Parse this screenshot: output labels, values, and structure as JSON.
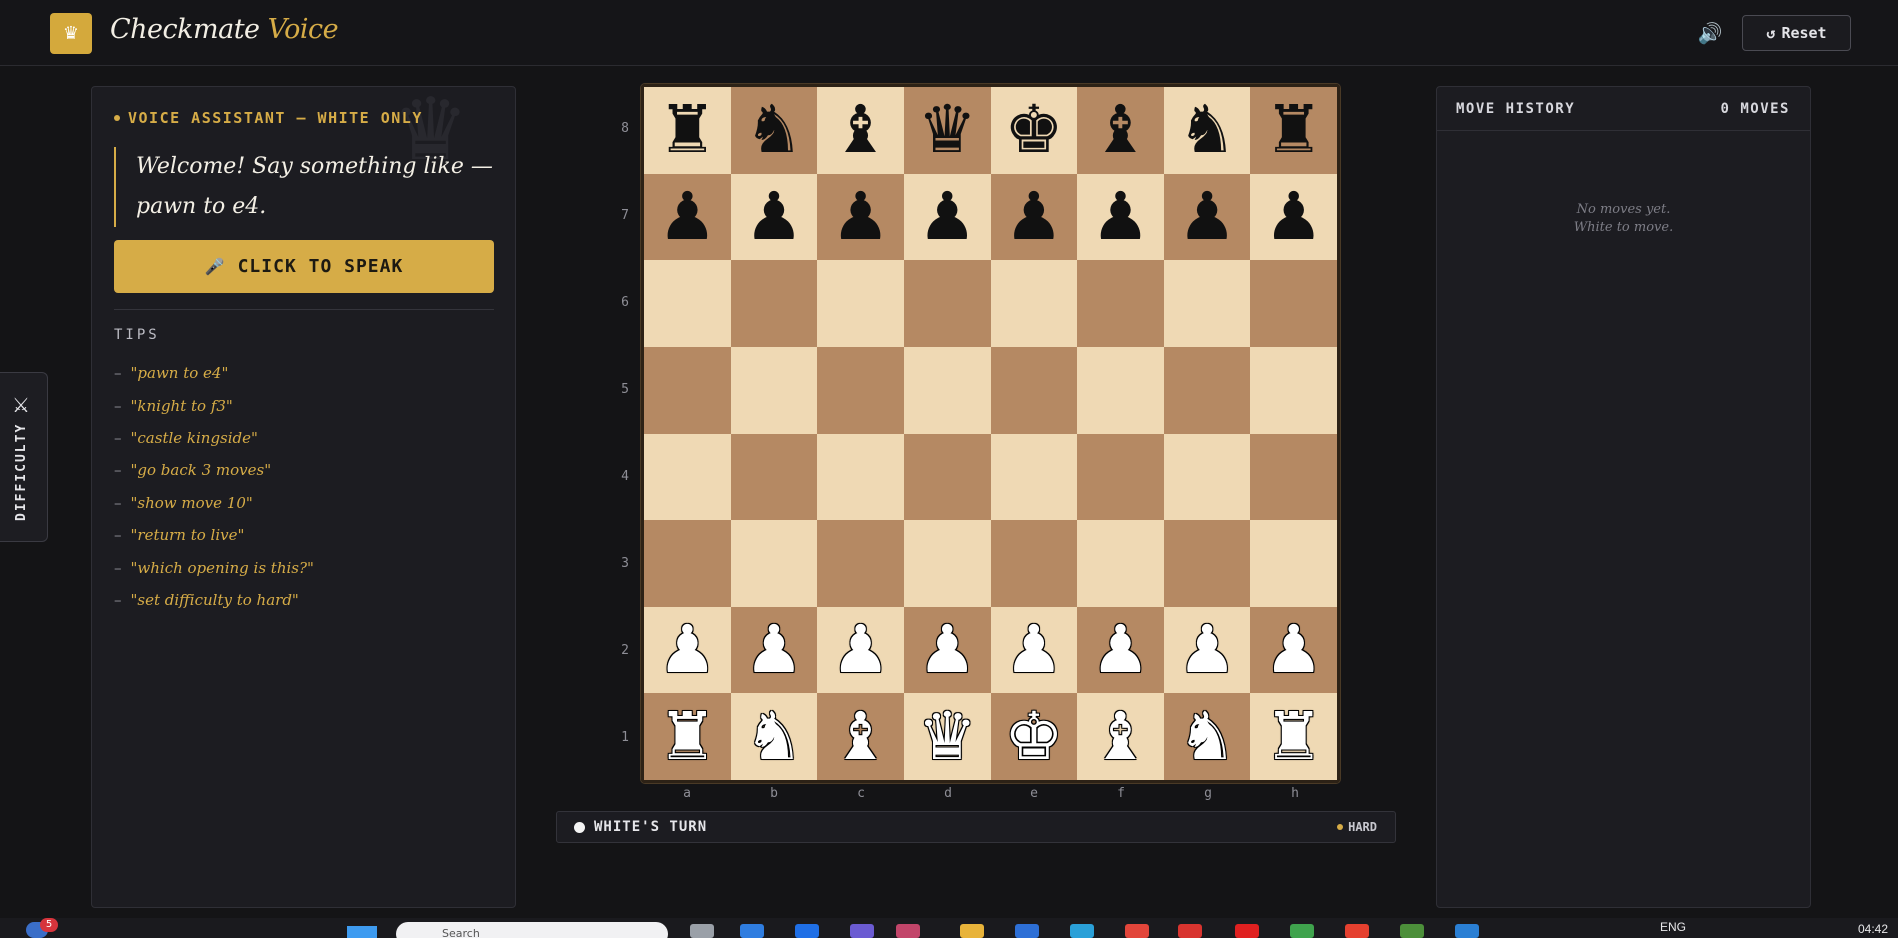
{
  "header": {
    "logo_icon": "♛",
    "brand_main": "Checkmate",
    "brand_accent": "Voice",
    "sound_icon": "🔊",
    "reset_icon": "↺",
    "reset_label": "Reset"
  },
  "voice_assistant": {
    "title": "VOICE ASSISTANT — WHITE ONLY",
    "message": "Welcome! Say something like — pawn to e4.",
    "speak_icon": "🎤",
    "speak_label": "CLICK TO SPEAK",
    "tips_title": "TIPS",
    "tips": [
      "\"pawn to e4\"",
      "\"knight to f3\"",
      "\"castle kingside\"",
      "\"go back 3 moves\"",
      "\"show move 10\"",
      "\"return to live\"",
      "\"which opening is this?\"",
      "\"set difficulty to hard\""
    ]
  },
  "difficulty_tab": {
    "icon": "⚔",
    "label": "DIFFICULTY"
  },
  "board": {
    "ranks": [
      "8",
      "7",
      "6",
      "5",
      "4",
      "3",
      "2",
      "1"
    ],
    "files": [
      "a",
      "b",
      "c",
      "d",
      "e",
      "f",
      "g",
      "h"
    ],
    "position": [
      [
        "r",
        "n",
        "b",
        "q",
        "k",
        "b",
        "n",
        "r"
      ],
      [
        "p",
        "p",
        "p",
        "p",
        "p",
        "p",
        "p",
        "p"
      ],
      [
        "",
        "",
        "",
        "",
        "",
        "",
        "",
        ""
      ],
      [
        "",
        "",
        "",
        "",
        "",
        "",
        "",
        ""
      ],
      [
        "",
        "",
        "",
        "",
        "",
        "",
        "",
        ""
      ],
      [
        "",
        "",
        "",
        "",
        "",
        "",
        "",
        ""
      ],
      [
        "P",
        "P",
        "P",
        "P",
        "P",
        "P",
        "P",
        "P"
      ],
      [
        "R",
        "N",
        "B",
        "Q",
        "K",
        "B",
        "N",
        "R"
      ]
    ],
    "light_color": "#efd9b4",
    "dark_color": "#b58963"
  },
  "status": {
    "turn": "WHITE'S TURN",
    "difficulty": "HARD"
  },
  "move_history": {
    "title": "MOVE HISTORY",
    "count": "0 MOVES",
    "empty_line1": "No moves yet.",
    "empty_line2": "White to move."
  },
  "taskbar": {
    "notification_count": "5",
    "search_placeholder": "Search",
    "language": "ENG",
    "time": "04:42"
  },
  "colors": {
    "accent": "#d6ac47",
    "background": "#141416",
    "panel": "#1c1c21"
  }
}
